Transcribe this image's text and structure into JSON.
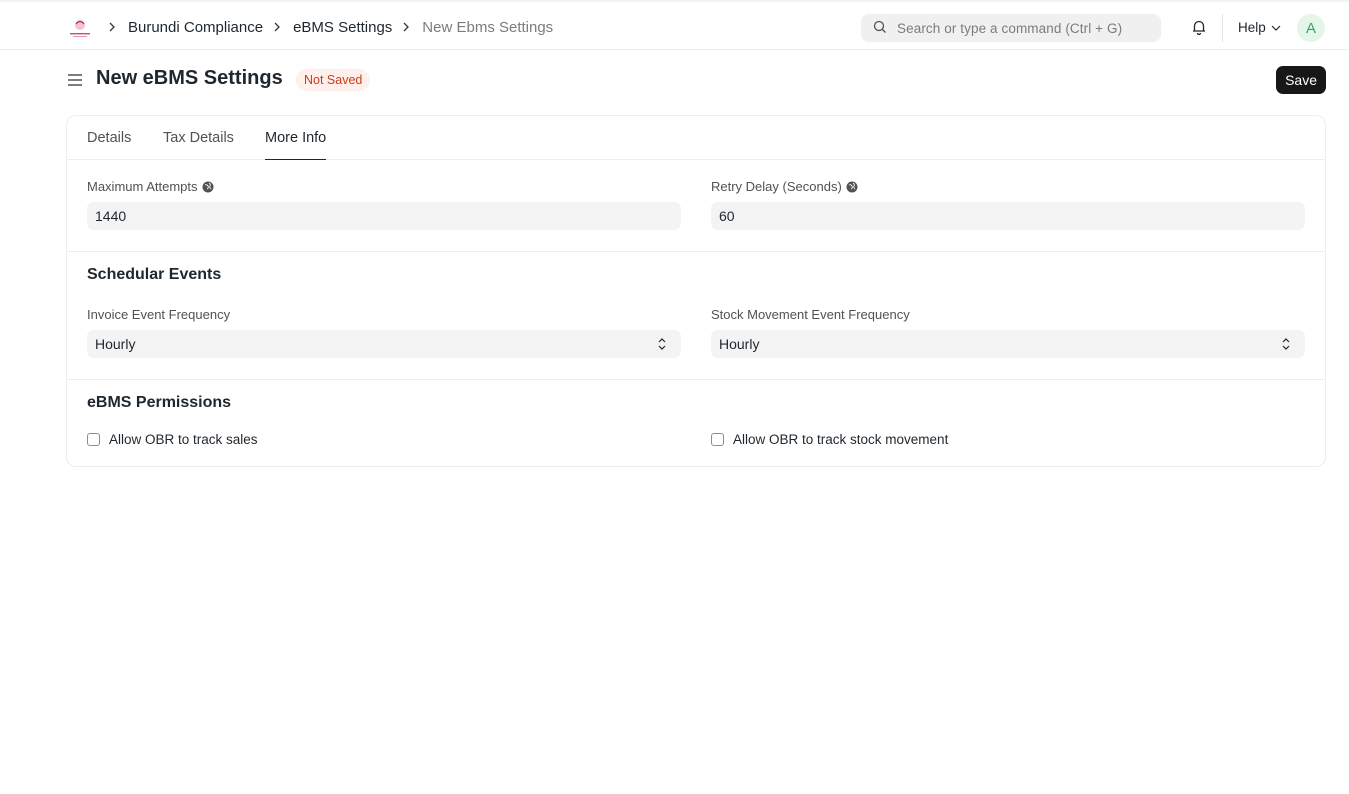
{
  "breadcrumbs": [
    {
      "label": "Burundi Compliance"
    },
    {
      "label": "eBMS Settings"
    },
    {
      "label": "New Ebms Settings"
    }
  ],
  "search": {
    "placeholder": "Search or type a command (Ctrl + G)"
  },
  "header": {
    "help_label": "Help",
    "avatar_initial": "A"
  },
  "page": {
    "title": "New eBMS Settings",
    "status": "Not Saved",
    "save_label": "Save"
  },
  "tabs": [
    {
      "label": "Details",
      "active": false
    },
    {
      "label": "Tax Details",
      "active": false
    },
    {
      "label": "More Info",
      "active": true
    }
  ],
  "more_info": {
    "max_attempts": {
      "label": "Maximum Attempts",
      "value": "1440"
    },
    "retry_delay": {
      "label": "Retry Delay (Seconds)",
      "value": "60"
    }
  },
  "schedular": {
    "title": "Schedular Events",
    "invoice_freq": {
      "label": "Invoice Event Frequency",
      "value": "Hourly"
    },
    "stock_freq": {
      "label": "Stock Movement Event Frequency",
      "value": "Hourly"
    }
  },
  "permissions": {
    "title": "eBMS Permissions",
    "track_sales": {
      "label": "Allow OBR to track sales",
      "checked": false
    },
    "track_stock": {
      "label": "Allow OBR to track stock movement",
      "checked": false
    }
  },
  "colors": {
    "accent": "#171717",
    "status_bg": "#fff0eb",
    "status_text": "#c73c1b",
    "avatar_bg": "#e4f5e9",
    "avatar_text": "#30a66d"
  }
}
